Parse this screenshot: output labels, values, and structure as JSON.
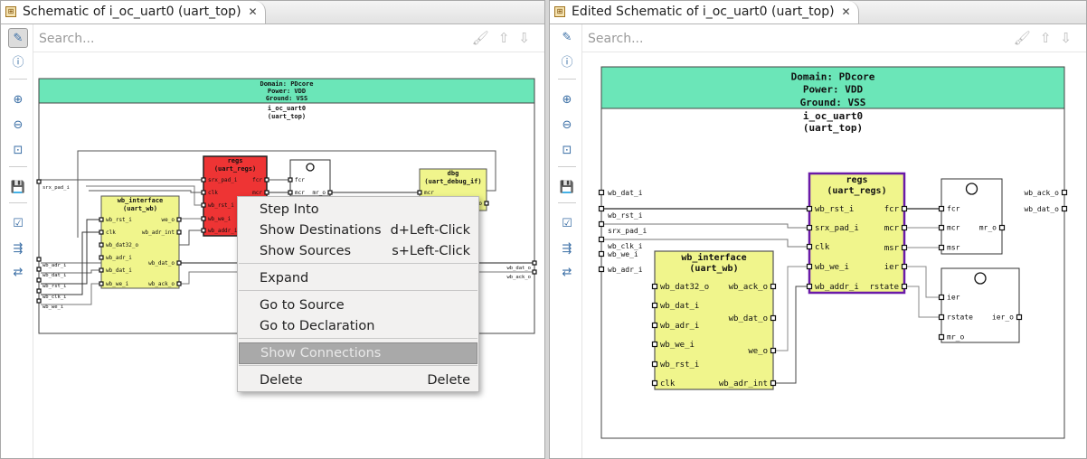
{
  "left_pane": {
    "tab_title": "Schematic of i_oc_uart0 (uart_top)",
    "search_placeholder": "Search...",
    "schematic": {
      "header": [
        "Domain: PDcore",
        "Power: VDD",
        "Ground: VSS"
      ],
      "instance": "i_oc_uart0",
      "module": "(uart_top)",
      "top_inputs": [
        "srx_pad_i",
        "wb_adr_i",
        "wb_dat_i",
        "wb_rst_i",
        "wb_clk_i",
        "wb_we_i"
      ],
      "top_outputs": [
        "wb_dat_o",
        "wb_ack_o"
      ],
      "regs": {
        "name": "regs",
        "module": "(uart_regs)",
        "inputs": [
          "srx_pad_i",
          "clk",
          "wb_rst_i",
          "wb_we_i",
          "wb_addr_i"
        ],
        "outputs": [
          "fcr",
          "mcr"
        ],
        "color": "#ee3434"
      },
      "wb_interface": {
        "name": "wb_interface",
        "module": "(uart_wb)",
        "inputs": [
          "wb_rst_i",
          "clk",
          "wb_dat32_o",
          "wb_adr_i",
          "wb_dat_i",
          "wb_we_i"
        ],
        "outputs": [
          "we_o",
          "wb_adr_int",
          "wb_dat_o",
          "wb_ack_o"
        ]
      },
      "gate": {
        "inputs": [
          "fcr",
          "mcr"
        ],
        "outputs": [
          "mr_o"
        ]
      },
      "dbg": {
        "name": "dbg",
        "module": "(uart_debug_if)",
        "inputs": [
          "mcr"
        ],
        "outputs": [
          "_o"
        ]
      }
    },
    "context_menu": [
      {
        "label": "Step Into",
        "shortcut": ""
      },
      {
        "label": "Show Destinations",
        "shortcut": "d+Left-Click"
      },
      {
        "label": "Show Sources",
        "shortcut": "s+Left-Click"
      },
      {
        "label": "Expand",
        "shortcut": ""
      },
      {
        "label": "Go to Source",
        "shortcut": ""
      },
      {
        "label": "Go to Declaration",
        "shortcut": ""
      },
      {
        "label": "Show Connections",
        "shortcut": "",
        "state": "highlighted-disabled"
      },
      {
        "label": "Delete",
        "shortcut": "Delete"
      }
    ]
  },
  "right_pane": {
    "tab_title": "Edited Schematic of i_oc_uart0 (uart_top)",
    "search_placeholder": "Search...",
    "schematic": {
      "header": [
        "Domain: PDcore",
        "Power: VDD",
        "Ground: VSS"
      ],
      "instance": "i_oc_uart0",
      "module": "(uart_top)",
      "top_inputs": [
        "wb_dat_i",
        "wb_rst_i",
        "srx_pad_i",
        "wb_clk_i",
        "wb_we_i",
        "wb_adr_i"
      ],
      "top_outputs": [
        "wb_ack_o",
        "wb_dat_o"
      ],
      "regs": {
        "name": "regs",
        "module": "(uart_regs)",
        "inputs": [
          "wb_rst_i",
          "srx_pad_i",
          "clk",
          "wb_we_i",
          "wb_addr_i"
        ],
        "outputs": [
          "fcr",
          "mcr",
          "msr",
          "ier",
          "rstate"
        ],
        "color": "#f0f58c",
        "border": "#6a1aa8"
      },
      "wb_interface": {
        "name": "wb_interface",
        "module": "(uart_wb)",
        "inputs": [
          "wb_dat32_o",
          "wb_dat_i",
          "wb_adr_i",
          "wb_we_i",
          "wb_rst_i",
          "clk"
        ],
        "outputs": [
          "wb_ack_o",
          "wb_dat_o",
          "we_o",
          "wb_adr_int"
        ]
      },
      "gate1": {
        "inputs": [
          "fcr",
          "mcr",
          "msr"
        ],
        "outputs": [
          "mr_o"
        ]
      },
      "gate2": {
        "inputs": [
          "ier",
          "rstate",
          "mr_o"
        ],
        "outputs": [
          "ier_o"
        ]
      }
    }
  },
  "toolbar_icons": [
    "edit-schematic-icon",
    "info-icon",
    "zoom-in-icon",
    "zoom-out-icon",
    "zoom-fit-icon",
    "save-icon",
    "checklist-icon",
    "expand-connections-icon",
    "swap-icon"
  ],
  "search_icons": [
    "clear-icon",
    "up-arrow-icon",
    "down-arrow-icon"
  ],
  "colors": {
    "header_green": "#6be6b8",
    "block_yellow": "#f0f58c",
    "selected_red": "#ee3434",
    "edited_border": "#6a1aa8"
  }
}
